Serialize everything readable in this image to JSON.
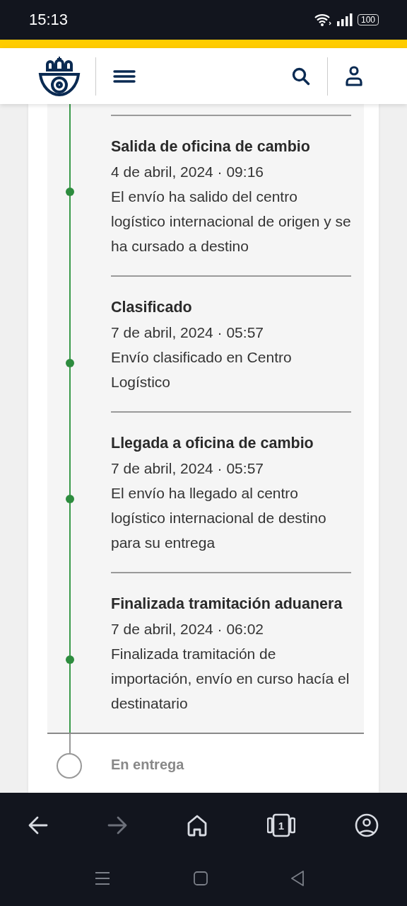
{
  "status_bar": {
    "time": "15:13",
    "battery": "100"
  },
  "events": [
    {
      "title": "Salida de oficina de cambio",
      "date": "4 de abril, 2024 · 09:16",
      "description": "El envío ha salido del centro logístico internacional de origen y se ha cursado a destino",
      "done": true
    },
    {
      "title": "Clasificado",
      "date": "7 de abril, 2024 · 05:57",
      "description": "Envío clasificado en Centro Logístico",
      "done": true
    },
    {
      "title": "Llegada a oficina de cambio",
      "date": "7 de abril, 2024 · 05:57",
      "description": "El envío ha llegado al centro logístico internacional de destino para su entrega",
      "done": true
    },
    {
      "title": "Finalizada tramitación aduanera",
      "date": "7 de abril, 2024 · 06:02",
      "description": "Finalizada tramitación de importación, envío en curso hacía el destinatario",
      "done": true
    }
  ],
  "next_step": {
    "title": "En entrega",
    "done": false
  },
  "browser_bar": {
    "tab_count": "1"
  }
}
